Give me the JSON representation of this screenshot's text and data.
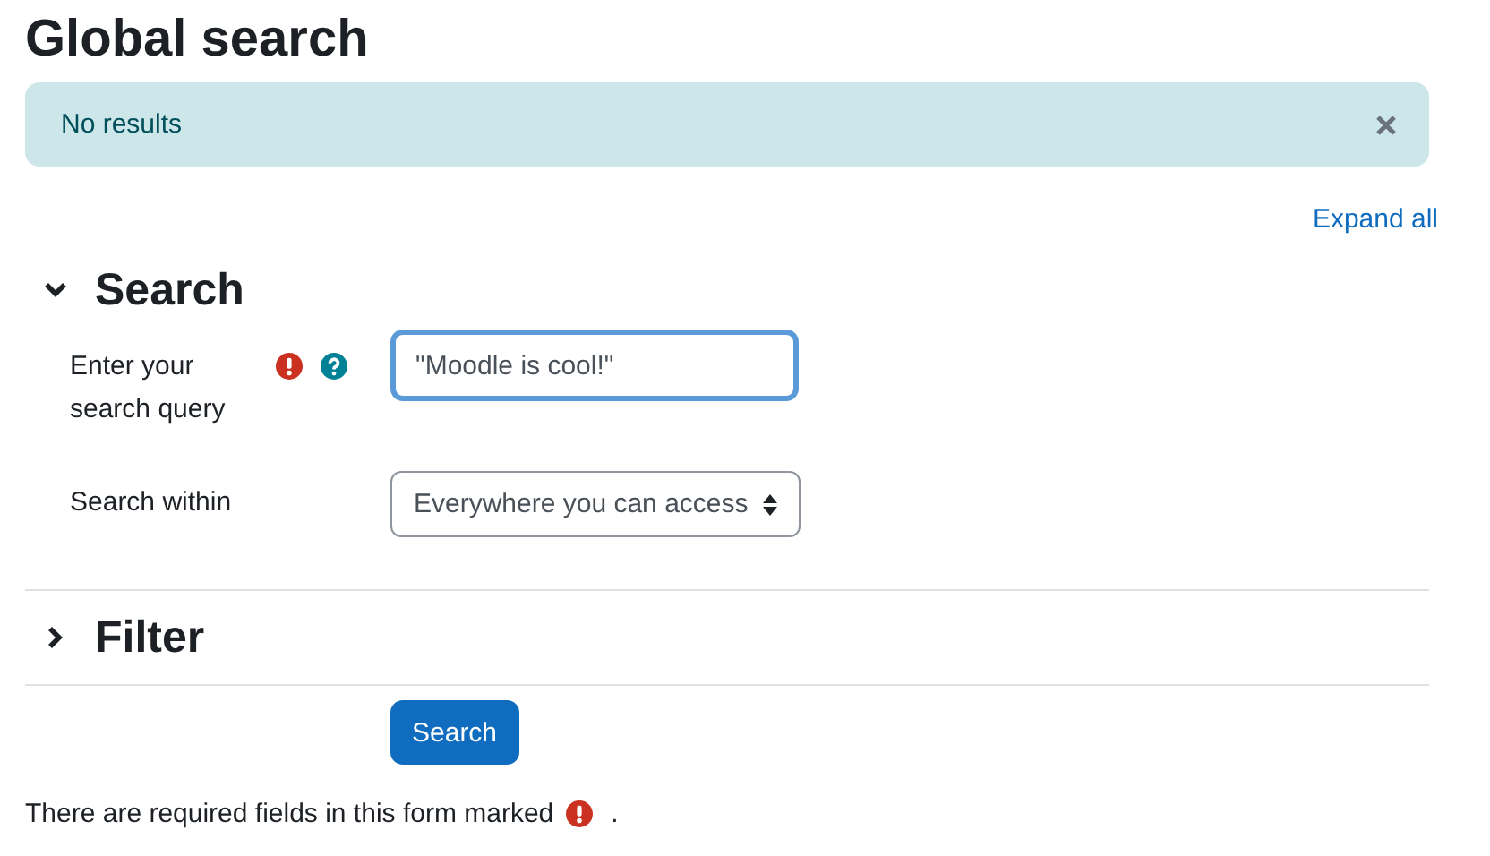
{
  "page": {
    "title": "Global search"
  },
  "alert": {
    "message": "No results"
  },
  "expand_all": "Expand all",
  "sections": [
    {
      "title": "Search",
      "expanded": true,
      "fields": [
        {
          "kind": "text",
          "label": "Enter your search query",
          "required": true,
          "help": true,
          "value": "\"Moodle is cool!\"",
          "focused": true
        },
        {
          "kind": "select",
          "label": "Search within",
          "required": false,
          "help": false,
          "value": "Everywhere you can access",
          "focused": false
        }
      ]
    },
    {
      "title": "Filter",
      "expanded": false
    }
  ],
  "submit_button": "Search",
  "footer": {
    "text": "There are required fields in this form marked",
    "end": "."
  }
}
